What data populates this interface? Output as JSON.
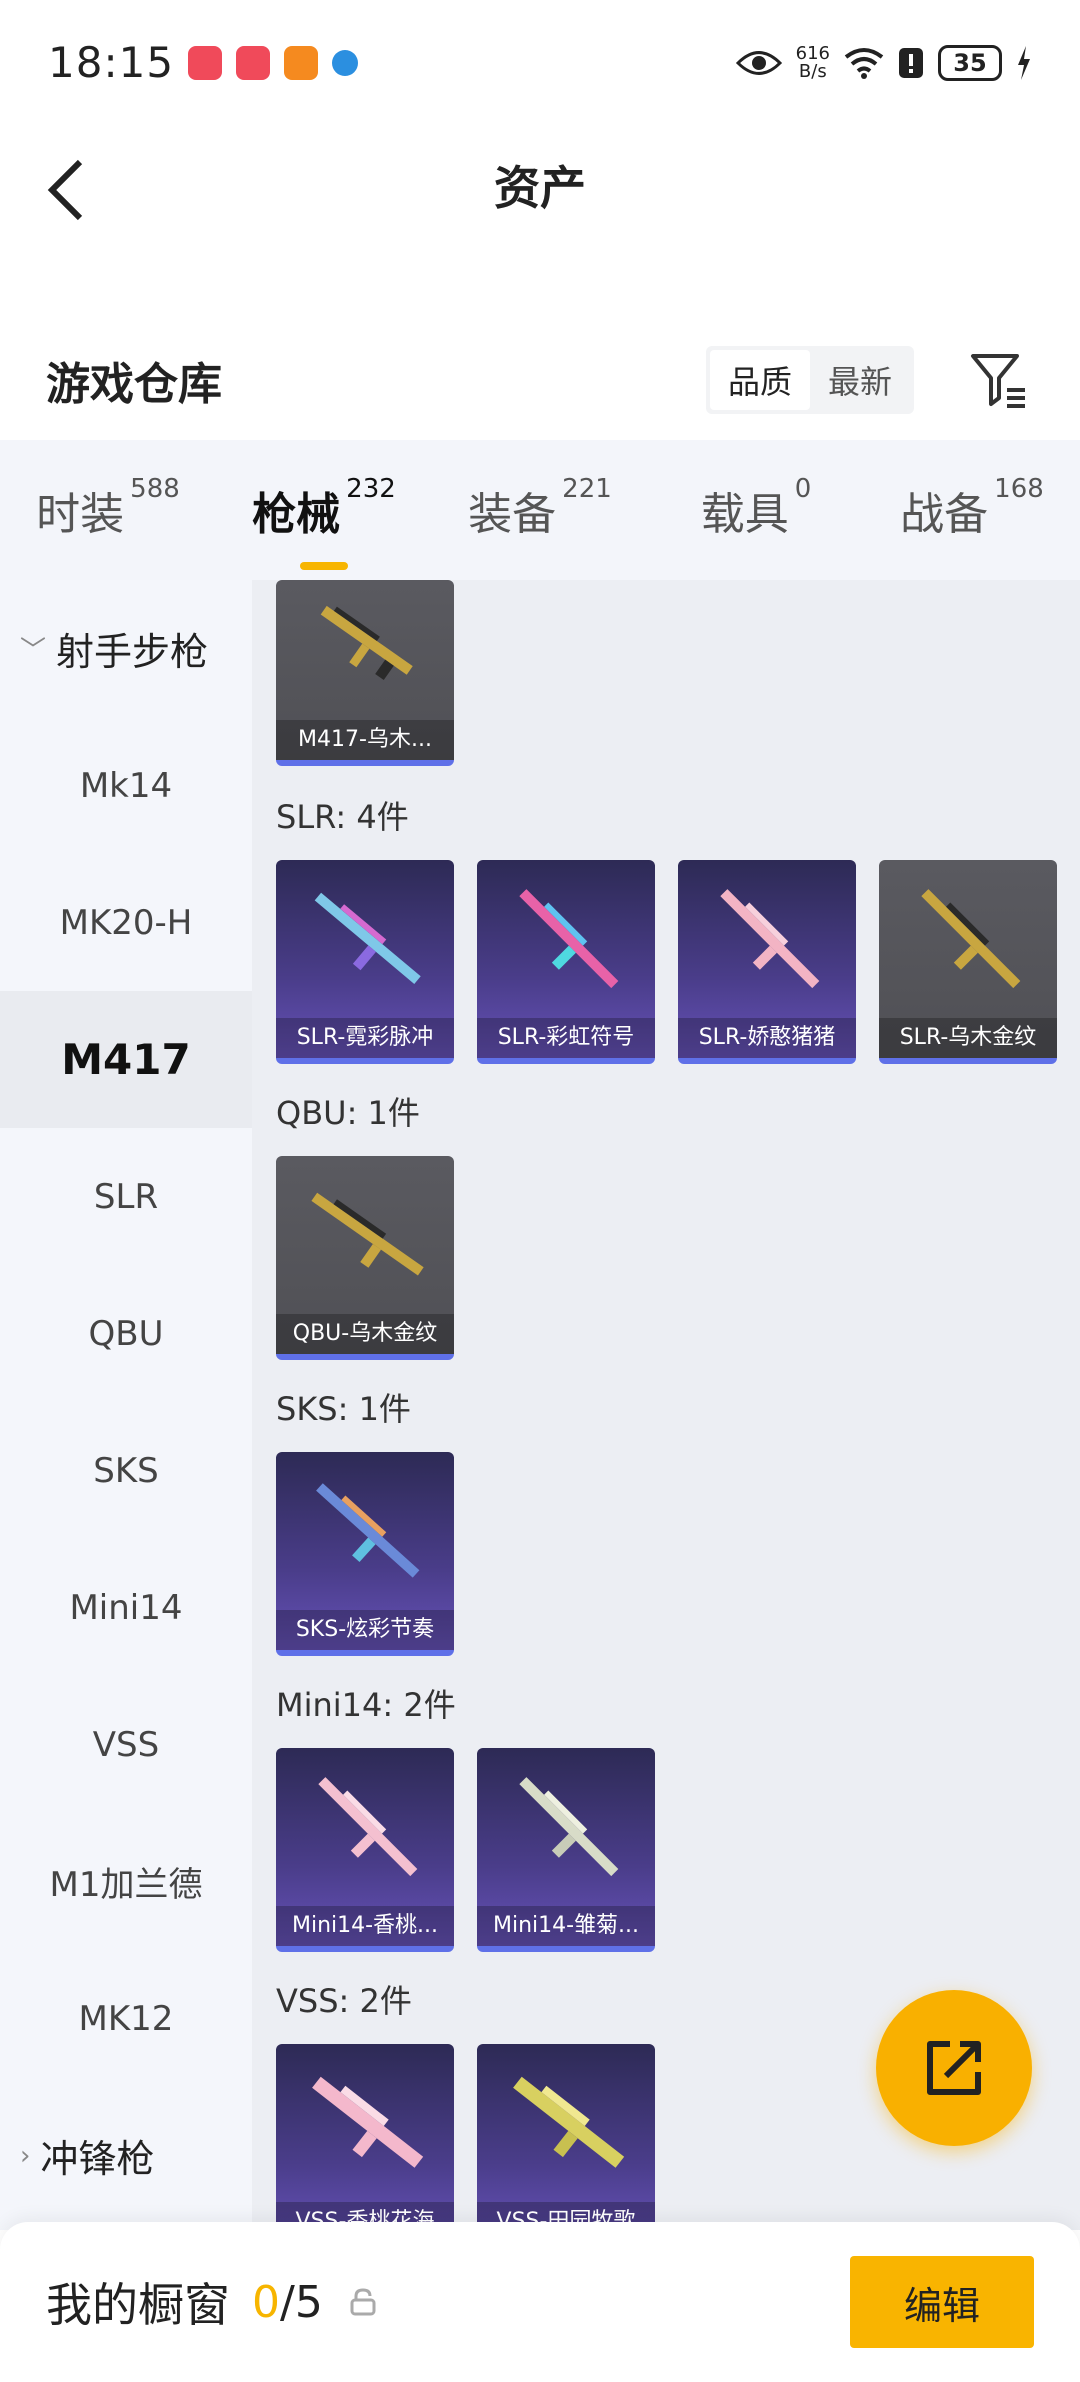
{
  "status_bar": {
    "time": "18:15",
    "net_speed_value": "616",
    "net_speed_unit": "B/s",
    "battery": "35"
  },
  "header": {
    "title": "资产"
  },
  "warehouse": {
    "title": "游戏仓库",
    "sort_options": [
      "品质",
      "最新"
    ],
    "sort_selected": "品质"
  },
  "tabs": [
    {
      "label": "时装",
      "count": "588"
    },
    {
      "label": "枪械",
      "count": "232"
    },
    {
      "label": "装备",
      "count": "221"
    },
    {
      "label": "载具",
      "count": "0"
    },
    {
      "label": "战备",
      "count": "168"
    }
  ],
  "sidebar": {
    "group_open": "射手步枪",
    "items": [
      "Mk14",
      "MK20-H",
      "M417",
      "SLR",
      "QBU",
      "SKS",
      "Mini14",
      "VSS",
      "M1加兰德",
      "MK12"
    ],
    "active": "M417",
    "group_closed": "冲锋枪"
  },
  "content": {
    "m417_items": [
      "M417-乌木..."
    ],
    "slr_label": "SLR: 4件",
    "slr_items": [
      "SLR-霓彩脉冲",
      "SLR-彩虹符号",
      "SLR-娇憨猪猪",
      "SLR-乌木金纹"
    ],
    "qbu_label": "QBU: 1件",
    "qbu_items": [
      "QBU-乌木金纹"
    ],
    "sks_label": "SKS: 1件",
    "sks_items": [
      "SKS-炫彩节奏"
    ],
    "mini14_label": "Mini14: 2件",
    "mini14_items": [
      "Mini14-香桃...",
      "Mini14-雏菊..."
    ],
    "vss_label": "VSS: 2件",
    "vss_items": [
      "VSS-香桃花海",
      "VSS-田园牧歌"
    ]
  },
  "bottom_bar": {
    "label": "我的橱窗",
    "current": "0",
    "separator": "/",
    "total": "5",
    "edit_label": "编辑"
  },
  "colors": {
    "accent": "#f7b500",
    "card_border": "#5f70e8",
    "purple_card": "#4a3d8a",
    "grey_card": "#55555a"
  }
}
